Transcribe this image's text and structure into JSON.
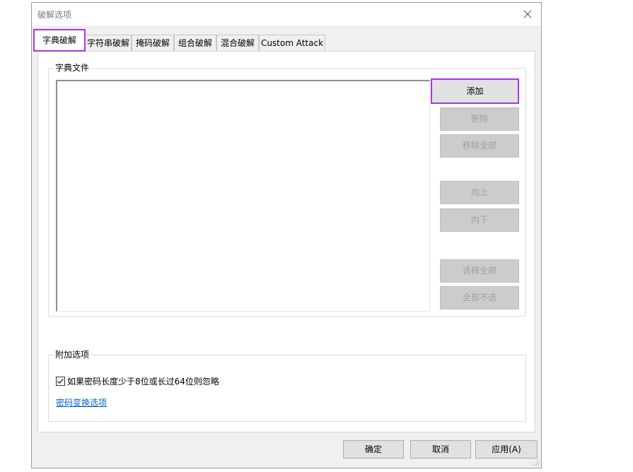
{
  "window": {
    "title": "破解选项"
  },
  "tabs": [
    {
      "label": "字典破解",
      "active": true
    },
    {
      "label": "字符串破解",
      "active": false
    },
    {
      "label": "掩码破解",
      "active": false
    },
    {
      "label": "组合破解",
      "active": false
    },
    {
      "label": "混合破解",
      "active": false
    },
    {
      "label": "Custom Attack",
      "active": false
    }
  ],
  "dictionary_group": {
    "label": "字典文件",
    "buttons": {
      "add": "添加",
      "delete": "删除",
      "remove_all": "移除全部",
      "move_up": "向上",
      "move_down": "向下",
      "select_all": "选择全部",
      "deselect_all": "全部不选"
    }
  },
  "extra_group": {
    "label": "附加选项",
    "ignore_length_checkbox": {
      "label": "如果密码长度少于8位或长过64位则忽略",
      "checked": true
    },
    "transform_link": "密码变换选项"
  },
  "footer": {
    "ok": "确定",
    "cancel": "取消",
    "apply": "应用(A)"
  },
  "colors": {
    "highlight": "#a637e3",
    "link": "#0066cc",
    "disabled_text": "#a0a0a0"
  }
}
